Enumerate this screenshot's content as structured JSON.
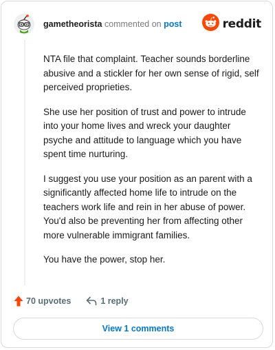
{
  "header": {
    "username": "gametheorista",
    "commented_text": "commented on",
    "post_link": "post",
    "logo_text": "reddit"
  },
  "comment": {
    "paragraphs": [
      "NTA file that complaint. Teacher sounds borderline abusive and a stickler for her own sense of rigid, self perceived proprieties.",
      "She use her position of trust and power to intrude into your home lives and wreck your daughter psyche and attitude to language which you have spent time nurturing.",
      "I suggest you use your position as an parent with a significantly affected home life to intrude on the teachers work life and rein in her abuse of power. You'd also be preventing her from affecting other more vulnerable immigrant families.",
      "You have the power, stop her."
    ]
  },
  "actions": {
    "upvotes_label": "70 upvotes",
    "reply_label": "1 reply",
    "view_comments_label": "View 1 comments"
  },
  "colors": {
    "brand": "#ff4500",
    "link": "#0079d3",
    "border": "#d7dadc"
  },
  "icons": {
    "avatar": "snoo-avatar-icon",
    "logo": "reddit-logo-icon",
    "upvote": "upvote-arrow-icon",
    "reply": "reply-arrow-icon"
  }
}
